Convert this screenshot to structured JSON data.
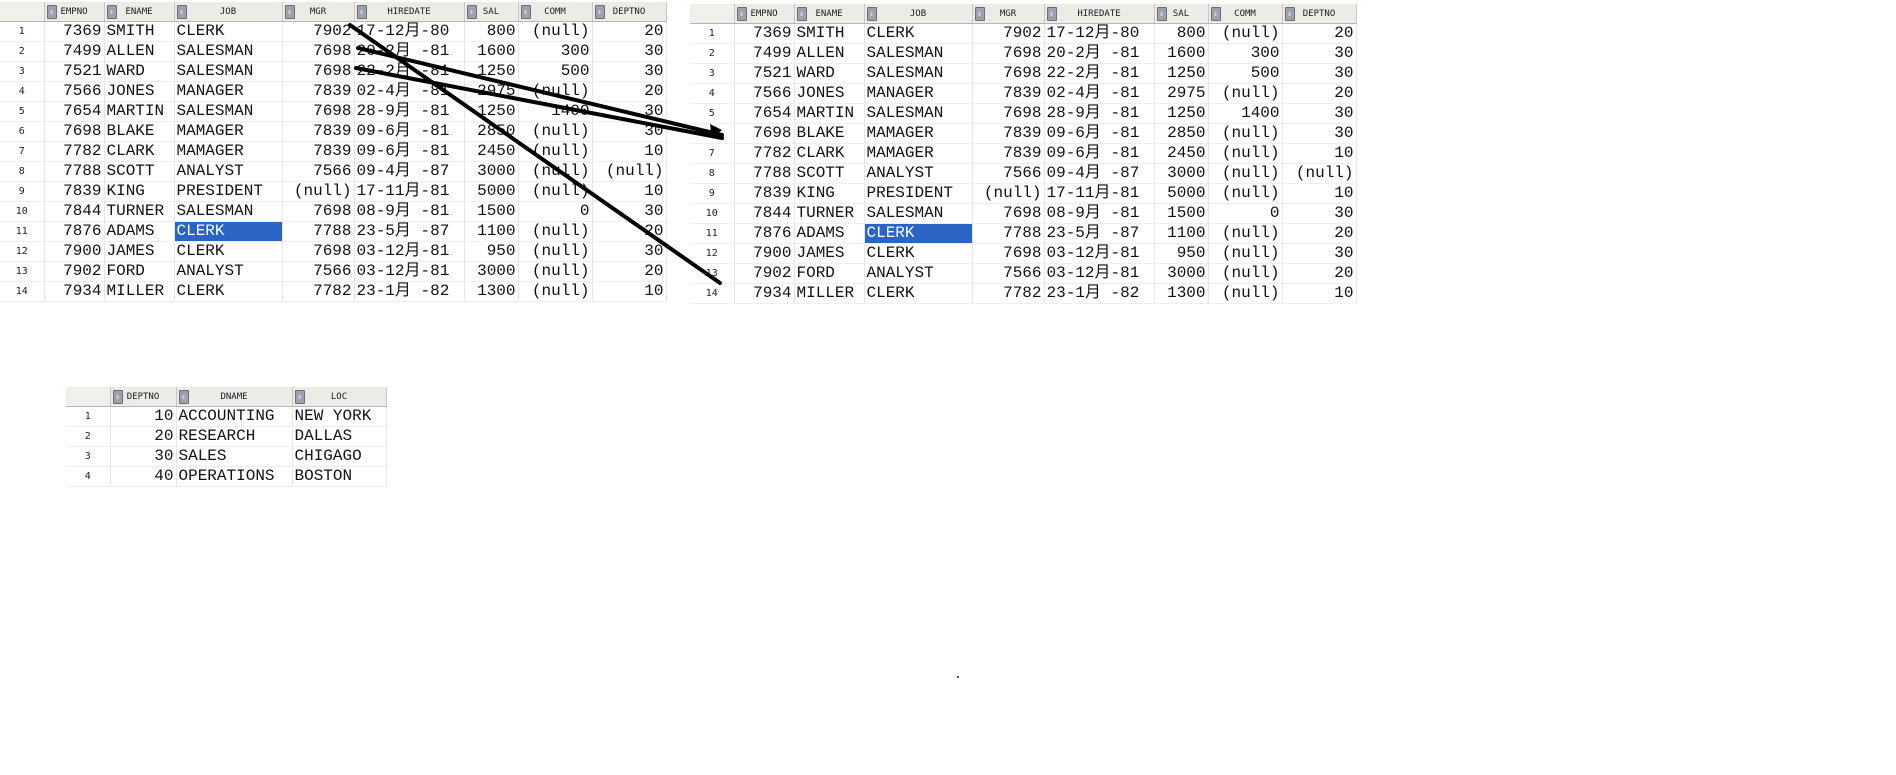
{
  "emp_columns": [
    "EMPNO",
    "ENAME",
    "JOB",
    "MGR",
    "HIREDATE",
    "SAL",
    "COMM",
    "DEPTNO"
  ],
  "emp_left_rows": [
    [
      "1",
      "7369",
      "SMITH",
      "CLERK",
      "7902",
      "17-12月-80",
      "800",
      "(null)",
      "20"
    ],
    [
      "2",
      "7499",
      "ALLEN",
      "SALESMAN",
      "7698",
      "20-2月 -81",
      "1600",
      "300",
      "30"
    ],
    [
      "3",
      "7521",
      "WARD",
      "SALESMAN",
      "7698",
      "22-2月 -81",
      "1250",
      "500",
      "30"
    ],
    [
      "4",
      "7566",
      "JONES",
      "MANAGER",
      "7839",
      "02-4月 -81",
      "2975",
      "(null)",
      "20"
    ],
    [
      "5",
      "7654",
      "MARTIN",
      "SALESMAN",
      "7698",
      "28-9月 -81",
      "1250",
      "1400",
      "30"
    ],
    [
      "6",
      "7698",
      "BLAKE",
      "MAMAGER",
      "7839",
      "09-6月 -81",
      "2850",
      "(null)",
      "30"
    ],
    [
      "7",
      "7782",
      "CLARK",
      "MAMAGER",
      "7839",
      "09-6月 -81",
      "2450",
      "(null)",
      "10"
    ],
    [
      "8",
      "7788",
      "SCOTT",
      "ANALYST",
      "7566",
      "09-4月 -87",
      "3000",
      "(null)",
      "(null)"
    ],
    [
      "9",
      "7839",
      "KING",
      "PRESIDENT",
      "(null)",
      "17-11月-81",
      "5000",
      "(null)",
      "10"
    ],
    [
      "10",
      "7844",
      "TURNER",
      "SALESMAN",
      "7698",
      "08-9月 -81",
      "1500",
      "0",
      "30"
    ],
    [
      "11",
      "7876",
      "ADAMS",
      "CLERK",
      "7788",
      "23-5月 -87",
      "1100",
      "(null)",
      "20"
    ],
    [
      "12",
      "7900",
      "JAMES",
      "CLERK",
      "7698",
      "03-12月-81",
      "950",
      "(null)",
      "30"
    ],
    [
      "13",
      "7902",
      "FORD",
      "ANALYST",
      "7566",
      "03-12月-81",
      "3000",
      "(null)",
      "20"
    ],
    [
      "14",
      "7934",
      "MILLER",
      "CLERK",
      "7782",
      "23-1月 -82",
      "1300",
      "(null)",
      "10"
    ]
  ],
  "emp_right_rows": [
    [
      "1",
      "7369",
      "SMITH",
      "CLERK",
      "7902",
      "17-12月-80",
      "800",
      "(null)",
      "20"
    ],
    [
      "2",
      "7499",
      "ALLEN",
      "SALESMAN",
      "7698",
      "20-2月 -81",
      "1600",
      "300",
      "30"
    ],
    [
      "3",
      "7521",
      "WARD",
      "SALESMAN",
      "7698",
      "22-2月 -81",
      "1250",
      "500",
      "30"
    ],
    [
      "4",
      "7566",
      "JONES",
      "MANAGER",
      "7839",
      "02-4月 -81",
      "2975",
      "(null)",
      "20"
    ],
    [
      "5",
      "7654",
      "MARTIN",
      "SALESMAN",
      "7698",
      "28-9月 -81",
      "1250",
      "1400",
      "30"
    ],
    [
      "6",
      "7698",
      "BLAKE",
      "MAMAGER",
      "7839",
      "09-6月 -81",
      "2850",
      "(null)",
      "30"
    ],
    [
      "7",
      "7782",
      "CLARK",
      "MAMAGER",
      "7839",
      "09-6月 -81",
      "2450",
      "(null)",
      "10"
    ],
    [
      "8",
      "7788",
      "SCOTT",
      "ANALYST",
      "7566",
      "09-4月 -87",
      "3000",
      "(null)",
      "(null)"
    ],
    [
      "9",
      "7839",
      "KING",
      "PRESIDENT",
      "(null)",
      "17-11月-81",
      "5000",
      "(null)",
      "10"
    ],
    [
      "10",
      "7844",
      "TURNER",
      "SALESMAN",
      "7698",
      "08-9月 -81",
      "1500",
      "0",
      "30"
    ],
    [
      "11",
      "7876",
      "ADAMS",
      "CLERK",
      "7788",
      "23-5月 -87",
      "1100",
      "(null)",
      "20"
    ],
    [
      "12",
      "7900",
      "JAMES",
      "CLERK",
      "7698",
      "03-12月-81",
      "950",
      "(null)",
      "30"
    ],
    [
      "13",
      "7902",
      "FORD",
      "ANALYST",
      "7566",
      "03-12月-81",
      "3000",
      "(null)",
      "20"
    ],
    [
      "14",
      "7934",
      "MILLER",
      "CLERK",
      "7782",
      "23-1月 -82",
      "1300",
      "(null)",
      "10"
    ]
  ],
  "dept_columns": [
    "DEPTNO",
    "DNAME",
    "LOC"
  ],
  "dept_rows": [
    [
      "1",
      "10",
      "ACCOUNTING",
      "NEW YORK"
    ],
    [
      "2",
      "20",
      "RESEARCH",
      "DALLAS"
    ],
    [
      "3",
      "30",
      "SALES",
      "CHIGAGO"
    ],
    [
      "4",
      "40",
      "OPERATIONS",
      "BOSTON"
    ]
  ],
  "selection": {
    "row": "11",
    "column": "JOB"
  },
  "colors": {
    "selection_bg": "#2a64c5",
    "header_bg": "#ecebe7",
    "annotation_line": "#000000"
  },
  "icons": {
    "column_header": "sort-icon"
  }
}
